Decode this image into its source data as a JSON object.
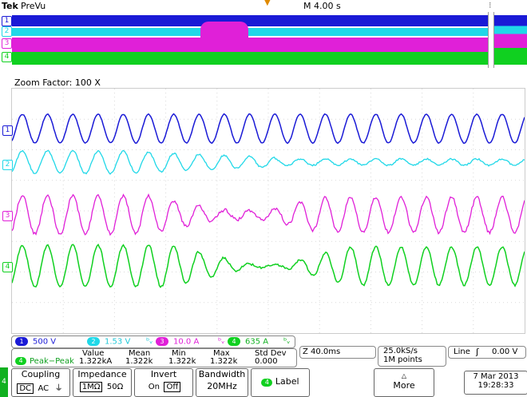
{
  "header": {
    "brand": "Tek",
    "state": "PreVu",
    "timebase": "M 4.00 s"
  },
  "zoom": {
    "label": "Zoom Factor: 100 X"
  },
  "channels": [
    {
      "num": "1",
      "color": "#1a1ad6",
      "scale": "500 V"
    },
    {
      "num": "2",
      "color": "#20d8e8",
      "scale": "1.53 V"
    },
    {
      "num": "3",
      "color": "#e020d8",
      "scale": "10.0 A"
    },
    {
      "num": "4",
      "color": "#10d020",
      "scale": "635 A"
    }
  ],
  "bw_symbol": "ᵇᵥ",
  "measurement": {
    "channel": "4",
    "name": "Peak−Peak",
    "headers": {
      "value": "Value",
      "mean": "Mean",
      "min": "Min",
      "max": "Max",
      "std": "Std Dev"
    },
    "values": {
      "value": "1.322kA",
      "mean": "1.322k",
      "min": "1.322k",
      "max": "1.322k",
      "std": "0.000"
    }
  },
  "zoom_pos": "Z 40.0ms",
  "acq": {
    "rate": "25.0kS/s",
    "points": "1M points"
  },
  "trigger": {
    "label": "Line",
    "level": "0.00 V"
  },
  "menu": {
    "coupling": {
      "title": "Coupling",
      "dc": "DC",
      "ac": "AC",
      "gnd": "⏚"
    },
    "impedance": {
      "title": "Impedance",
      "opt1": "1MΩ",
      "opt2": "50Ω"
    },
    "invert": {
      "title": "Invert",
      "on": "On",
      "off": "Off"
    },
    "bandwidth": {
      "title": "Bandwidth",
      "value": "20MHz"
    },
    "label": {
      "num": "4",
      "text": "Label"
    },
    "more": {
      "text": "More"
    },
    "datetime": {
      "date": "7 Mar 2013",
      "time": "19:28:33"
    }
  }
}
